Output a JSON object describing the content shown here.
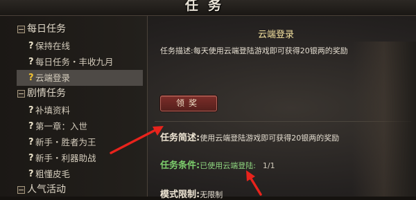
{
  "window": {
    "title": "任务"
  },
  "sidebar": {
    "categories": [
      {
        "label": "每日任务",
        "items": [
          {
            "label": "保持在线"
          },
          {
            "label": "每日任务・丰收九月"
          },
          {
            "label": "云端登录",
            "selected": true
          }
        ]
      },
      {
        "label": "剧情任务",
        "items": [
          {
            "label": "补填资料"
          },
          {
            "label": "第一章：入世"
          },
          {
            "label": "新手・胜者为王"
          },
          {
            "label": "新手・利器助战"
          },
          {
            "label": "粗懂皮毛"
          }
        ]
      },
      {
        "label": "人气活动"
      }
    ],
    "quest_marker": "?"
  },
  "quest": {
    "title": "云端登录",
    "description": "任务描述:每天使用云端登陆游戏即可获得20银两的奖励",
    "claim_button": "领奖",
    "summary_label": "任务简述:",
    "summary_text": "使用云端登陆游戏即可获得20银两的奖励",
    "condition_label": "任务条件:",
    "condition_text": "已使用云端登陆:",
    "condition_count": "1/1",
    "limit_label": "模式限制:",
    "limit_text": "无限制"
  },
  "colors": {
    "annotation_arrow": "#e8231c",
    "condition_green": "#7ccd6c",
    "title_gold": "#f5e3a0"
  }
}
